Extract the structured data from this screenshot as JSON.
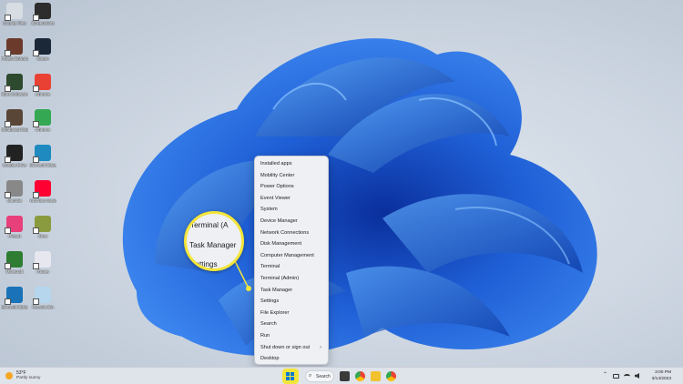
{
  "desktop": {
    "icons": [
      {
        "label": "Google Files",
        "color": "#d8dde3"
      },
      {
        "label": "Screenshots",
        "color": "#2d2d2d"
      },
      {
        "label": "Project Enhancer",
        "color": "#6b3a2a"
      },
      {
        "label": "Steam",
        "color": "#1b2838"
      },
      {
        "label": "Bbox Software",
        "color": "#2e4a2e"
      },
      {
        "label": "Chrome",
        "color": "#e94235"
      },
      {
        "label": "Windowed Explorer",
        "color": "#5a4636"
      },
      {
        "label": "Chrome",
        "color": "#34a853"
      },
      {
        "label": "Google Drive",
        "color": "#222222"
      },
      {
        "label": "Microsoft Edge",
        "color": "#1f8ac0"
      },
      {
        "label": "Mumble",
        "color": "#888888"
      },
      {
        "label": "YouTube Music",
        "color": "#ff0033"
      },
      {
        "label": "Picsart",
        "color": "#e8407a"
      },
      {
        "label": "Xbox",
        "color": "#8a9b3f"
      },
      {
        "label": "Minecraft",
        "color": "#2e7d32"
      },
      {
        "label": "iTunes",
        "color": "#e7e7ef"
      },
      {
        "label": "Microsoft Edge",
        "color": "#1a73b8"
      },
      {
        "label": "Recycle Bin",
        "color": "#b6d6ee"
      }
    ]
  },
  "menu": {
    "items": [
      {
        "label": "Installed apps",
        "submenu": false
      },
      {
        "label": "Mobility Center",
        "submenu": false
      },
      {
        "label": "Power Options",
        "submenu": false
      },
      {
        "label": "Event Viewer",
        "submenu": false
      },
      {
        "label": "System",
        "submenu": false
      },
      {
        "label": "Device Manager",
        "submenu": false
      },
      {
        "label": "Network Connections",
        "submenu": false
      },
      {
        "label": "Disk Management",
        "submenu": false
      },
      {
        "label": "Computer Management",
        "submenu": false
      },
      {
        "label": "Terminal",
        "submenu": false
      },
      {
        "label": "Terminal (Admin)",
        "submenu": false
      },
      {
        "label": "Task Manager",
        "submenu": false
      },
      {
        "label": "Settings",
        "submenu": false
      },
      {
        "label": "File Explorer",
        "submenu": false
      },
      {
        "label": "Search",
        "submenu": false
      },
      {
        "label": "Run",
        "submenu": false
      },
      {
        "label": "Shut down or sign out",
        "submenu": true
      },
      {
        "label": "Desktop",
        "submenu": false
      }
    ],
    "submenu_arrow": "›"
  },
  "callout": {
    "line1": "Terminal (A",
    "line2": "Task Manager",
    "line3": "Settings",
    "highlight_color": "#f3e53a"
  },
  "taskbar": {
    "weather_temp": "53°F",
    "weather_condition": "Partly sunny",
    "search_label": "Search",
    "search_icon": "⌕",
    "tray_chevron": "⌃",
    "time": "3:00 PM",
    "date": "3/14/2023"
  }
}
